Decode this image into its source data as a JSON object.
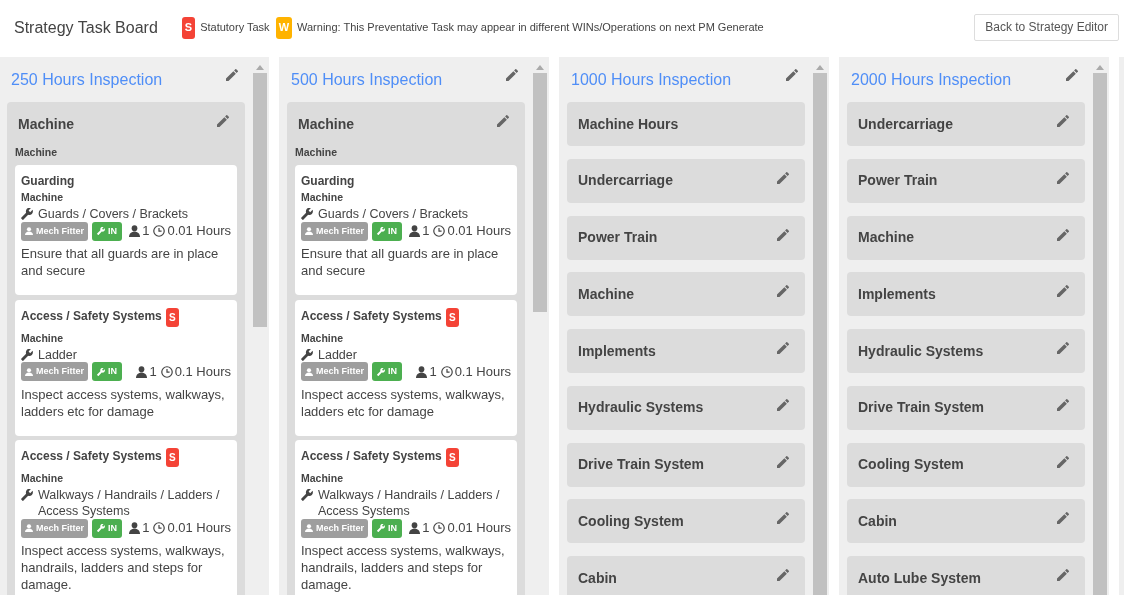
{
  "header": {
    "title": "Strategy Task Board",
    "legend": [
      {
        "kind": "statutory",
        "mark": "S",
        "label": "Statutory Task"
      },
      {
        "kind": "warning",
        "mark": "W",
        "label": "Warning: This Preventative Task may appear in different WINs/Operations on next PM Generate"
      }
    ],
    "back_button": "Back to Strategy Editor"
  },
  "columns": [
    {
      "title": "250 Hours Inspection",
      "groups": [
        {
          "title": "Machine",
          "editable": true,
          "subtitle": "Machine",
          "tasks": [
            {
              "title": "Guarding",
              "component": "Machine",
              "location": "Guards / Covers / Brackets",
              "trade": "Mech Fitter",
              "task_type": "IN",
              "people": "1",
              "duration": "0.01 Hours",
              "description": "Ensure that all guards are in place and secure"
            },
            {
              "title": "Access / Safety Systems",
              "badge": "S",
              "component": "Machine",
              "location": "Ladder",
              "trade": "Mech Fitter",
              "task_type": "IN",
              "people": "1",
              "duration": "0.1 Hours",
              "description": "Inspect access systems, walkways, ladders etc for damage"
            },
            {
              "title": "Access / Safety Systems",
              "badge": "S",
              "component": "Machine",
              "location": "Walkways / Handrails / Ladders / Access Systems",
              "trade": "Mech Fitter",
              "task_type": "IN",
              "people": "1",
              "duration": "0.01 Hours",
              "description": "Inspect access systems, walkways, handrails, ladders and steps for damage."
            }
          ]
        }
      ]
    },
    {
      "title": "500 Hours Inspection",
      "groups": [
        {
          "title": "Machine",
          "editable": true,
          "subtitle": "Machine",
          "tasks": [
            {
              "title": "Guarding",
              "component": "Machine",
              "location": "Guards / Covers / Brackets",
              "trade": "Mech Fitter",
              "task_type": "IN",
              "people": "1",
              "duration": "0.01 Hours",
              "description": "Ensure that all guards are in place and secure"
            },
            {
              "title": "Access / Safety Systems",
              "badge": "S",
              "component": "Machine",
              "location": "Ladder",
              "trade": "Mech Fitter",
              "task_type": "IN",
              "people": "1",
              "duration": "0.1 Hours",
              "description": "Inspect access systems, walkways, ladders etc for damage"
            },
            {
              "title": "Access / Safety Systems",
              "badge": "S",
              "component": "Machine",
              "location": "Walkways / Handrails / Ladders / Access Systems",
              "trade": "Mech Fitter",
              "task_type": "IN",
              "people": "1",
              "duration": "0.01 Hours",
              "description": "Inspect access systems, walkways, handrails, ladders and steps for damage."
            }
          ]
        }
      ]
    },
    {
      "title": "1000 Hours Inspection",
      "groups": [
        {
          "title": "Machine Hours",
          "editable": false
        },
        {
          "title": "Undercarriage",
          "editable": true
        },
        {
          "title": "Power Train",
          "editable": true
        },
        {
          "title": "Machine",
          "editable": true
        },
        {
          "title": "Implements",
          "editable": true
        },
        {
          "title": "Hydraulic Systems",
          "editable": true
        },
        {
          "title": "Drive Train System",
          "editable": true
        },
        {
          "title": "Cooling System",
          "editable": true
        },
        {
          "title": "Cabin",
          "editable": true
        }
      ]
    },
    {
      "title": "2000 Hours Inspection",
      "groups": [
        {
          "title": "Undercarriage",
          "editable": true
        },
        {
          "title": "Power Train",
          "editable": true
        },
        {
          "title": "Machine",
          "editable": true
        },
        {
          "title": "Implements",
          "editable": true
        },
        {
          "title": "Hydraulic Systems",
          "editable": true
        },
        {
          "title": "Drive Train System",
          "editable": true
        },
        {
          "title": "Cooling System",
          "editable": true
        },
        {
          "title": "Cabin",
          "editable": true
        },
        {
          "title": "Auto Lube System",
          "editable": true
        }
      ]
    }
  ]
}
